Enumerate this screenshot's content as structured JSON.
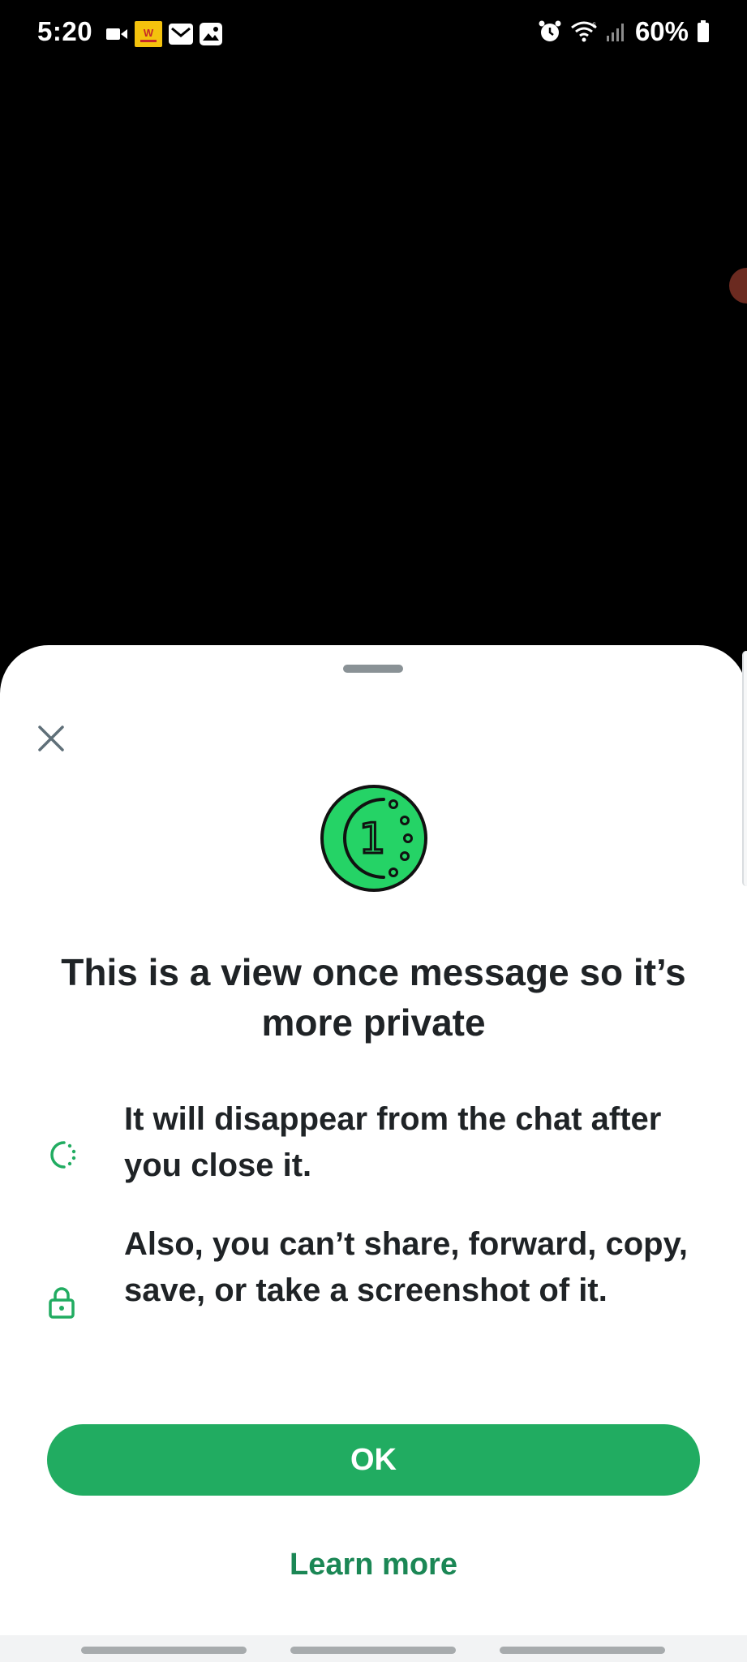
{
  "status_bar": {
    "time": "5:20",
    "battery": "60%",
    "icons_left": [
      "video-camera-icon",
      "app-notification-icon",
      "mail-icon",
      "gallery-icon"
    ],
    "icons_right": [
      "alarm-icon",
      "wifi-icon",
      "signal-icon",
      "battery-icon"
    ]
  },
  "sheet": {
    "title": "This is a view once message so it’s more private",
    "features": [
      {
        "icon": "dotted-circle-icon",
        "text": "It will disappear from the chat after you close it."
      },
      {
        "icon": "lock-icon",
        "text": "Also, you can’t share, forward, copy, save, or take a screenshot of it."
      }
    ],
    "ok_label": "OK",
    "learn_more_label": "Learn more",
    "view_once_badge": "1"
  },
  "colors": {
    "accent": "#21ac61",
    "accent_dark": "#1b8755",
    "icon_green": "#25d366",
    "text": "#1f2326",
    "close_icon": "#5f6f78",
    "handle": "#8a9296"
  }
}
